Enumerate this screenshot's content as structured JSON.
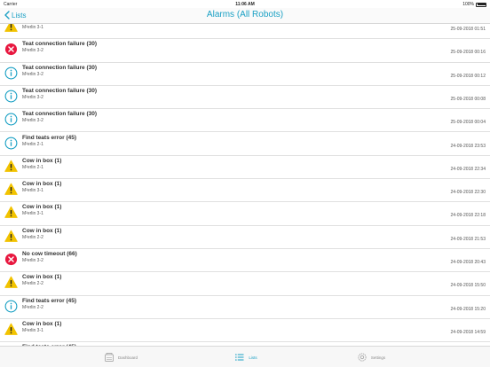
{
  "status_bar": {
    "carrier": "Carrier",
    "time": "11:06 AM",
    "battery": "100%"
  },
  "nav": {
    "back_label": "Lists",
    "title": "Alarms (All Robots)"
  },
  "colors": {
    "accent": "#1aa0c4",
    "warning": "#f2c300",
    "error": "#e8173f",
    "info": "#1aa0c4"
  },
  "alarms": [
    {
      "severity": "warning",
      "icon": "warning-icon",
      "title": "Cow in box (1)",
      "robot": "M²erlin 3-1",
      "timestamp": "25-09-2018 01:51"
    },
    {
      "severity": "error",
      "icon": "error-icon",
      "title": "Teat connection failure (30)",
      "robot": "M²erlin 3-2",
      "timestamp": "25-09-2018 00:16"
    },
    {
      "severity": "info",
      "icon": "info-icon",
      "title": "Teat connection failure (30)",
      "robot": "M²erlin 3-2",
      "timestamp": "25-09-2018 00:12"
    },
    {
      "severity": "info",
      "icon": "info-icon",
      "title": "Teat connection failure (30)",
      "robot": "M²erlin 3-2",
      "timestamp": "25-09-2018 00:08"
    },
    {
      "severity": "info",
      "icon": "info-icon",
      "title": "Teat connection failure (30)",
      "robot": "M²erlin 3-2",
      "timestamp": "25-09-2018 00:04"
    },
    {
      "severity": "info",
      "icon": "info-icon",
      "title": "Find teats error (45)",
      "robot": "M²erlin 2-1",
      "timestamp": "24-09-2018 23:53"
    },
    {
      "severity": "warning",
      "icon": "warning-icon",
      "title": "Cow in box (1)",
      "robot": "M²erlin 2-1",
      "timestamp": "24-09-2018 22:34"
    },
    {
      "severity": "warning",
      "icon": "warning-icon",
      "title": "Cow in box (1)",
      "robot": "M²erlin 3-1",
      "timestamp": "24-09-2018 22:30"
    },
    {
      "severity": "warning",
      "icon": "warning-icon",
      "title": "Cow in box (1)",
      "robot": "M²erlin 3-1",
      "timestamp": "24-09-2018 22:18"
    },
    {
      "severity": "warning",
      "icon": "warning-icon",
      "title": "Cow in box (1)",
      "robot": "M²erlin 2-2",
      "timestamp": "24-09-2018 21:53"
    },
    {
      "severity": "error",
      "icon": "error-icon",
      "title": "No cow timeout (66)",
      "robot": "M²erlin 3-2",
      "timestamp": "24-09-2018 20:43"
    },
    {
      "severity": "warning",
      "icon": "warning-icon",
      "title": "Cow in box (1)",
      "robot": "M²erlin 2-2",
      "timestamp": "24-09-2018 15:50"
    },
    {
      "severity": "info",
      "icon": "info-icon",
      "title": "Find teats error (45)",
      "robot": "M²erlin 2-2",
      "timestamp": "24-09-2018 15:20"
    },
    {
      "severity": "warning",
      "icon": "warning-icon",
      "title": "Cow in box (1)",
      "robot": "M²erlin 3-1",
      "timestamp": "24-09-2018 14:59"
    },
    {
      "severity": "info",
      "icon": "info-icon",
      "title": "Find teats error (45)",
      "robot": "",
      "timestamp": ""
    }
  ],
  "tabs": [
    {
      "name": "tab-dashboard",
      "icon": "dashboard-icon",
      "label": "Dashboard",
      "active": false
    },
    {
      "name": "tab-lists",
      "icon": "lists-icon",
      "label": "Lists",
      "active": true
    },
    {
      "name": "tab-settings",
      "icon": "settings-icon",
      "label": "Settings",
      "active": false
    }
  ]
}
